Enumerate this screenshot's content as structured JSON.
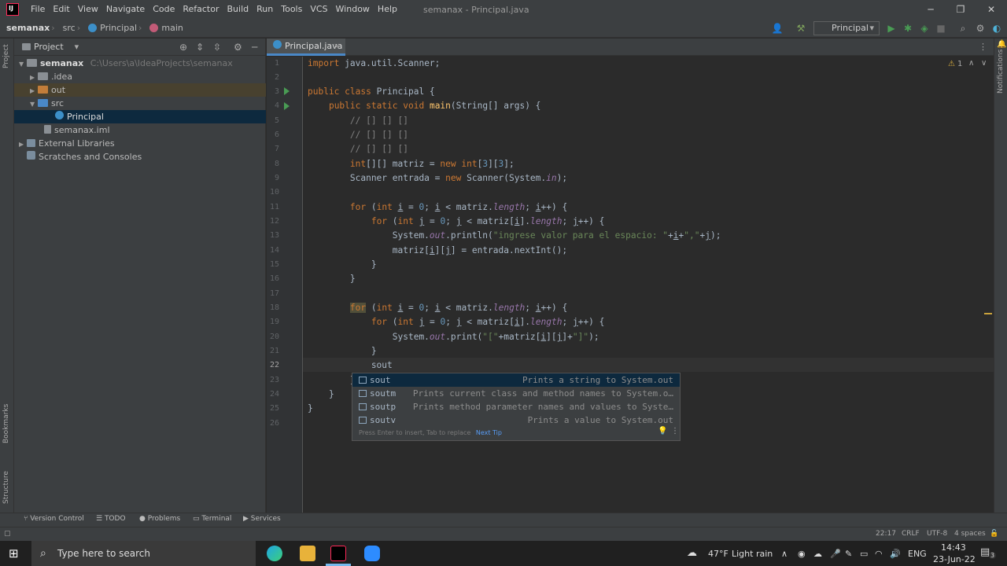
{
  "titlebar": {
    "menu": [
      "File",
      "Edit",
      "View",
      "Navigate",
      "Code",
      "Refactor",
      "Build",
      "Run",
      "Tools",
      "VCS",
      "Window",
      "Help"
    ],
    "title": "semanax - Principal.java"
  },
  "navbar": {
    "project": "semanax",
    "folder": "src",
    "file": "Principal",
    "method": "main",
    "run_config": "Principal"
  },
  "project_panel": {
    "header": "Project",
    "root_name": "semanax",
    "root_path": "C:\\Users\\a\\IdeaProjects\\semanax",
    "items": [
      ".idea",
      "out",
      "src",
      "Principal",
      "semanax.iml",
      "External Libraries",
      "Scratches and Consoles"
    ]
  },
  "left_strip": {
    "project": "Project",
    "bookmarks": "Bookmarks",
    "structure": "Structure"
  },
  "right_strip": {
    "notifications": "Notifications"
  },
  "editor": {
    "tab": "Principal.java",
    "warning_count": "1",
    "line_numbers": [
      "1",
      "2",
      "3",
      "4",
      "5",
      "6",
      "7",
      "8",
      "9",
      "10",
      "11",
      "12",
      "13",
      "14",
      "15",
      "16",
      "17",
      "18",
      "19",
      "20",
      "21",
      "22",
      "23",
      "24",
      "25",
      "26"
    ]
  },
  "completion": {
    "items": [
      {
        "name": "sout",
        "desc": "Prints a string to System.out"
      },
      {
        "name": "soutm",
        "desc": "Prints current class and method names to System.o…"
      },
      {
        "name": "soutp",
        "desc": "Prints method parameter names and values to Syste…"
      },
      {
        "name": "soutv",
        "desc": "Prints a value to System.out"
      }
    ],
    "footer": "Press Enter to insert, Tab to replace",
    "next_tip": "Next Tip"
  },
  "tool_windows": [
    "Version Control",
    "TODO",
    "Problems",
    "Terminal",
    "Services"
  ],
  "status": {
    "position": "22:17",
    "line_sep": "CRLF",
    "encoding": "UTF-8",
    "indent": "4 spaces"
  },
  "taskbar": {
    "search_placeholder": "Type here to search",
    "weather_temp": "47°F",
    "weather_desc": "Light rain",
    "lang": "ENG",
    "time": "14:43",
    "date": "23-Jun-22",
    "notif_count": "3"
  }
}
